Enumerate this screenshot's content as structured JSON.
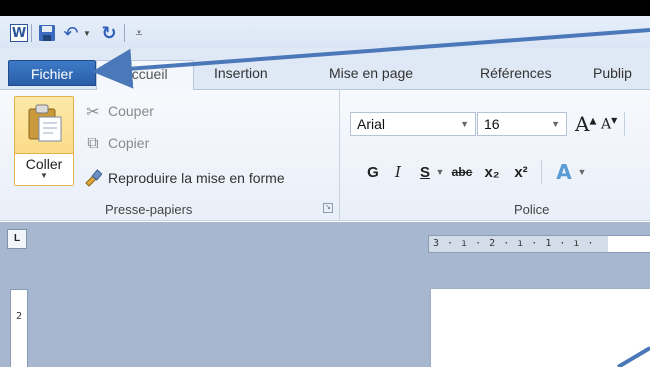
{
  "quick_access": {
    "app_letter": "W",
    "items": [
      "word-icon",
      "save-icon",
      "undo-icon",
      "redo-icon",
      "customize-icon"
    ]
  },
  "tabs": {
    "file": "Fichier",
    "home": "Accueil",
    "insert": "Insertion",
    "layout": "Mise en page",
    "references": "Références",
    "mailings": "Publip"
  },
  "clipboard": {
    "paste": "Coller",
    "cut": "Couper",
    "copy": "Copier",
    "format_painter": "Reproduire la mise en forme",
    "group_label": "Presse-papiers"
  },
  "font": {
    "name": "Arial",
    "size": "16",
    "bold": "G",
    "italic": "I",
    "underline": "S",
    "strikethrough": "abc",
    "subscript": "x₂",
    "superscript": "x²",
    "grow": "A",
    "shrink": "A",
    "text_effect": "A",
    "group_label": "Police"
  },
  "document": {
    "corner_glyph": "L",
    "h_ruler_text": "3 · ı · 2 · ı · 1 · ı ·",
    "v_ruler_text": "2"
  },
  "colors": {
    "file_tab": "#2a5ea8",
    "arrow": "#4a78b8",
    "paste_highlight": "#f9d376"
  }
}
